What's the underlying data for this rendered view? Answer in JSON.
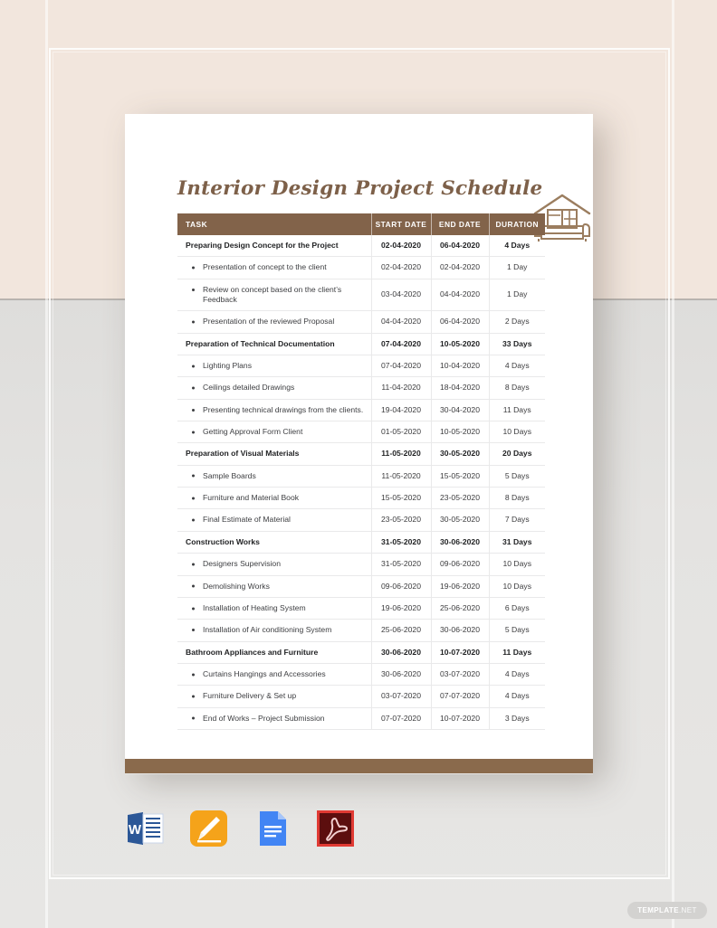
{
  "document": {
    "title": "Interior Design Project Schedule",
    "logo_icon": "house-sofa-icon",
    "accent_brown": "#82634a",
    "title_color": "#7d6049",
    "footer_bar_color": "#8a6a4c"
  },
  "table": {
    "columns": [
      "TASK",
      "START DATE",
      "END DATE",
      "DURATION"
    ],
    "rows": [
      {
        "type": "group",
        "task": "Preparing Design Concept for the Project",
        "start": "02-04-2020",
        "end": "06-04-2020",
        "duration": "4 Days"
      },
      {
        "type": "sub",
        "task": "Presentation of concept to the client",
        "start": "02-04-2020",
        "end": "02-04-2020",
        "duration": "1 Day"
      },
      {
        "type": "sub",
        "task": "Review on concept based on the client’s Feedback",
        "start": "03-04-2020",
        "end": "04-04-2020",
        "duration": "1 Day"
      },
      {
        "type": "sub",
        "task": "Presentation of the reviewed Proposal",
        "start": "04-04-2020",
        "end": "06-04-2020",
        "duration": "2 Days"
      },
      {
        "type": "group",
        "task": "Preparation of Technical Documentation",
        "start": "07-04-2020",
        "end": "10-05-2020",
        "duration": "33 Days"
      },
      {
        "type": "sub",
        "task": "Lighting Plans",
        "start": "07-04-2020",
        "end": "10-04-2020",
        "duration": "4 Days"
      },
      {
        "type": "sub",
        "task": "Ceilings detailed Drawings",
        "start": "11-04-2020",
        "end": "18-04-2020",
        "duration": "8 Days"
      },
      {
        "type": "sub",
        "task": "Presenting technical drawings from the clients.",
        "start": "19-04-2020",
        "end": "30-04-2020",
        "duration": "11 Days"
      },
      {
        "type": "sub",
        "task": "Getting Approval Form Client",
        "start": "01-05-2020",
        "end": "10-05-2020",
        "duration": "10 Days"
      },
      {
        "type": "group",
        "task": "Preparation of Visual Materials",
        "start": "11-05-2020",
        "end": "30-05-2020",
        "duration": "20 Days"
      },
      {
        "type": "sub",
        "task": "Sample Boards",
        "start": "11-05-2020",
        "end": "15-05-2020",
        "duration": "5 Days"
      },
      {
        "type": "sub",
        "task": "Furniture and Material Book",
        "start": "15-05-2020",
        "end": "23-05-2020",
        "duration": "8 Days"
      },
      {
        "type": "sub",
        "task": "Final Estimate of Material",
        "start": "23-05-2020",
        "end": "30-05-2020",
        "duration": "7 Days"
      },
      {
        "type": "group",
        "task": "Construction Works",
        "start": "31-05-2020",
        "end": "30-06-2020",
        "duration": "31 Days"
      },
      {
        "type": "sub",
        "task": "Designers Supervision",
        "start": "31-05-2020",
        "end": "09-06-2020",
        "duration": "10 Days"
      },
      {
        "type": "sub",
        "task": "Demolishing Works",
        "start": "09-06-2020",
        "end": "19-06-2020",
        "duration": "10 Days"
      },
      {
        "type": "sub",
        "task": "Installation of Heating System",
        "start": "19-06-2020",
        "end": "25-06-2020",
        "duration": "6 Days"
      },
      {
        "type": "sub",
        "task": "Installation of Air conditioning System",
        "start": "25-06-2020",
        "end": "30-06-2020",
        "duration": "5 Days"
      },
      {
        "type": "group",
        "task": "Bathroom Appliances and Furniture",
        "start": "30-06-2020",
        "end": "10-07-2020",
        "duration": "11 Days"
      },
      {
        "type": "sub",
        "task": "Curtains Hangings and Accessories",
        "start": "30-06-2020",
        "end": "03-07-2020",
        "duration": "4 Days"
      },
      {
        "type": "sub",
        "task": "Furniture Delivery & Set up",
        "start": "03-07-2020",
        "end": "07-07-2020",
        "duration": "4 Days"
      },
      {
        "type": "sub",
        "task": "End of Works – Project Submission",
        "start": "07-07-2020",
        "end": "10-07-2020",
        "duration": "3 Days"
      }
    ]
  },
  "formats": [
    {
      "name": "microsoft-word-icon",
      "label": "W",
      "color": "#2b5797"
    },
    {
      "name": "apple-pages-icon",
      "label": "",
      "color": "#f5a31a"
    },
    {
      "name": "google-docs-icon",
      "label": "",
      "color": "#4285f4"
    },
    {
      "name": "adobe-pdf-icon",
      "label": "",
      "color": "#8c1010"
    }
  ],
  "watermark": {
    "name": "TEMPLATE",
    "suffix": ".NET"
  }
}
